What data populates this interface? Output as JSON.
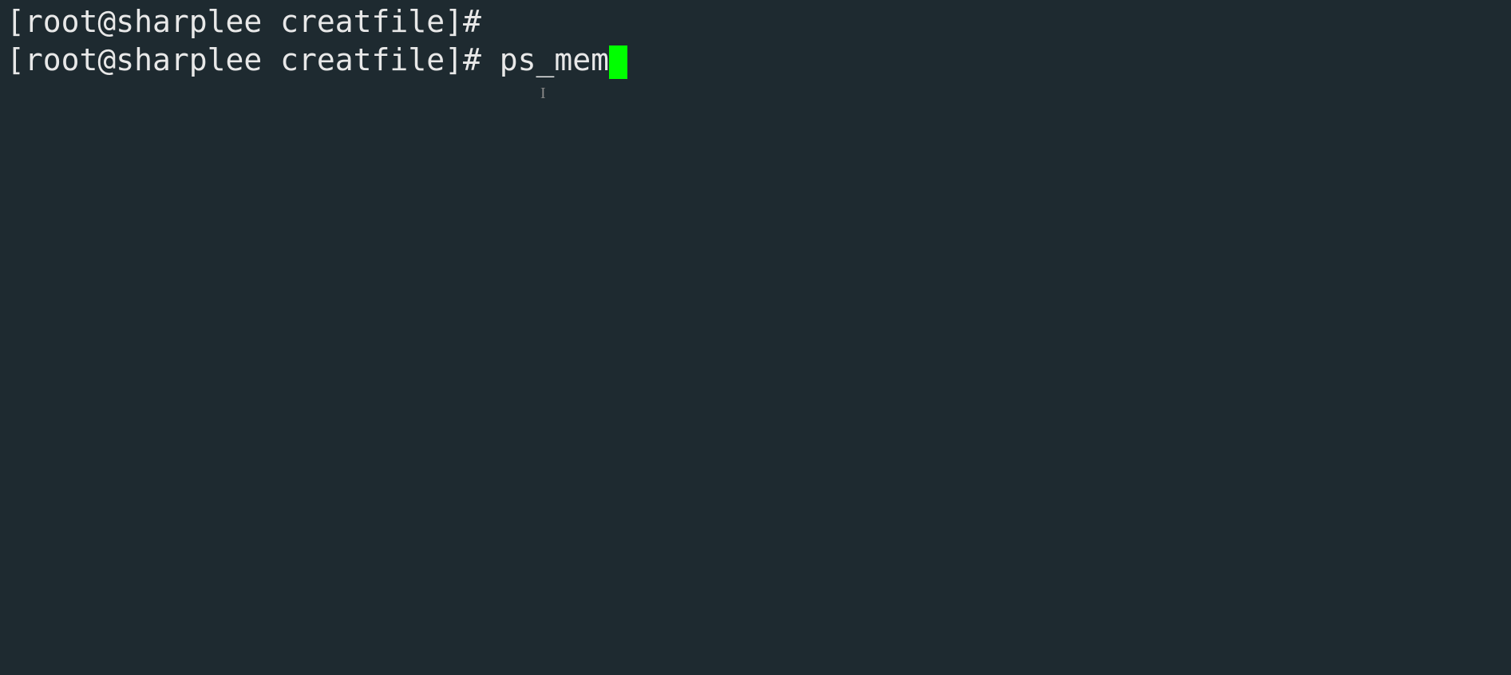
{
  "terminal": {
    "lines": [
      {
        "prompt": "[root@sharplee creatfile]#",
        "command": ""
      },
      {
        "prompt": "[root@sharplee creatfile]#",
        "command": " ps_mem"
      }
    ],
    "cursor_visible": true,
    "text_cursor_glyph": "I"
  }
}
